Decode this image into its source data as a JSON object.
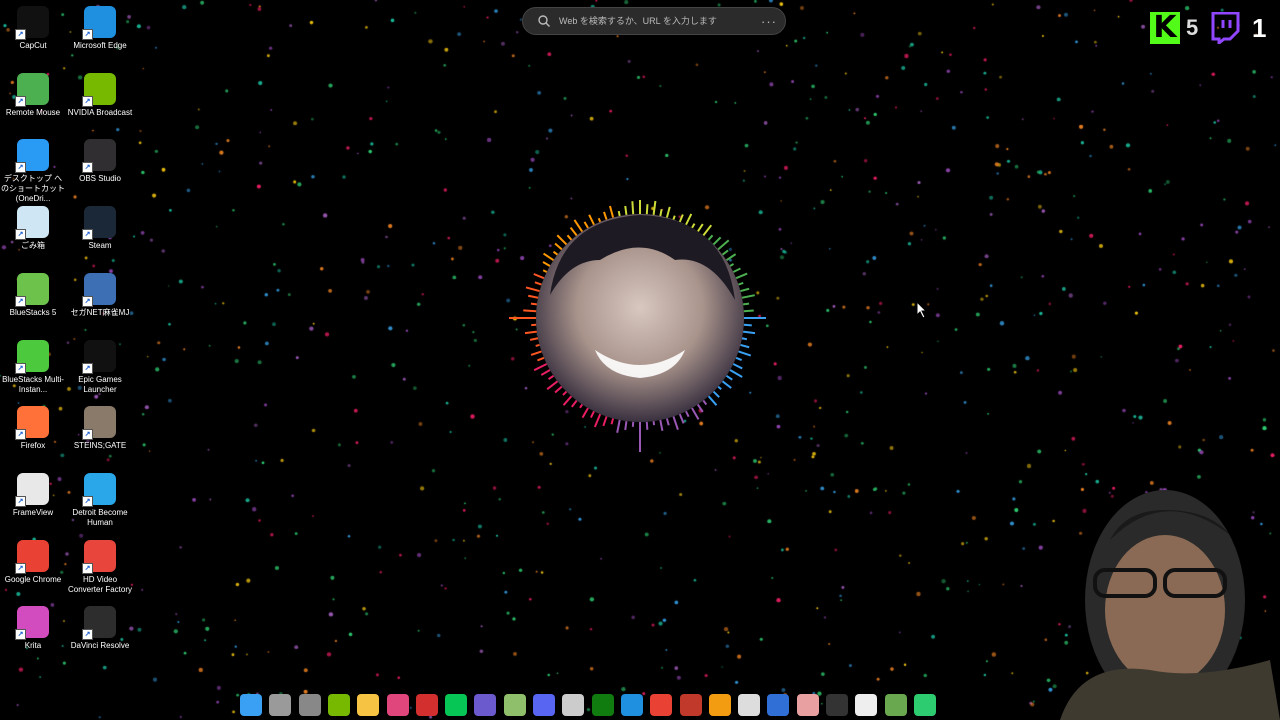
{
  "desktop_icons": [
    {
      "label": "CapCut",
      "icon": "capcut-icon",
      "color": "#111111"
    },
    {
      "label": "Microsoft Edge",
      "icon": "edge-icon",
      "color": "#1f8fe0"
    },
    {
      "label": "Remote Mouse",
      "icon": "remote-mouse-icon",
      "color": "#4caf50"
    },
    {
      "label": "NVIDIA Broadcast",
      "icon": "nvidia-broadcast-icon",
      "color": "#76b900"
    },
    {
      "label": "デスクトップ へのショートカット (OneDri...",
      "icon": "onedrive-icon",
      "color": "#2a9bf4"
    },
    {
      "label": "OBS Studio",
      "icon": "obs-icon",
      "color": "#302e31"
    },
    {
      "label": "ごみ箱",
      "icon": "recycle-bin-icon",
      "color": "#cfe6f5"
    },
    {
      "label": "Steam",
      "icon": "steam-icon",
      "color": "#1b2838"
    },
    {
      "label": "BlueStacks 5",
      "icon": "bluestacks-icon",
      "color": "#6cc24a"
    },
    {
      "label": "セガNET麻雀MJ",
      "icon": "sega-mj-icon",
      "color": "#3d6fb5"
    },
    {
      "label": "BlueStacks Multi-Instan...",
      "icon": "bluestacks-multi-icon",
      "color": "#4cc93c"
    },
    {
      "label": "Epic Games Launcher",
      "icon": "epic-games-icon",
      "color": "#111111"
    },
    {
      "label": "Firefox",
      "icon": "firefox-icon",
      "color": "#ff7139"
    },
    {
      "label": "STEINS;GATE",
      "icon": "steins-gate-icon",
      "color": "#8a7a6a"
    },
    {
      "label": "FrameView",
      "icon": "frameview-icon",
      "color": "#e8e8e8"
    },
    {
      "label": "Detroit Become Human",
      "icon": "detroit-icon",
      "color": "#2aa7e8"
    },
    {
      "label": "Google Chrome",
      "icon": "chrome-icon",
      "color": "#e94235"
    },
    {
      "label": "HD Video Converter Factory",
      "icon": "hd-video-converter-icon",
      "color": "#e8453c"
    },
    {
      "label": "Krita",
      "icon": "krita-icon",
      "color": "#d34cbf"
    },
    {
      "label": "DaVinci Resolve",
      "icon": "davinci-icon",
      "color": "#2d2d2d"
    }
  ],
  "search": {
    "placeholder": "Web を検索するか、URL を入力します",
    "more": "···"
  },
  "overlay": {
    "kick_letter": "K",
    "kick_count": "5",
    "twitch_count": "1"
  },
  "taskbar_icons": [
    {
      "icon": "windows-start-icon",
      "color": "#3aa0f3"
    },
    {
      "icon": "task-view-icon",
      "color": "#9a9a9a"
    },
    {
      "icon": "settings-icon",
      "color": "#888888"
    },
    {
      "icon": "nvidia-icon",
      "color": "#76b900"
    },
    {
      "icon": "file-explorer-icon",
      "color": "#f6c343"
    },
    {
      "icon": "lips-app-icon",
      "color": "#e0457b"
    },
    {
      "icon": "record-icon",
      "color": "#d32f2f"
    },
    {
      "icon": "line-icon",
      "color": "#06c755"
    },
    {
      "icon": "chat-app-icon",
      "color": "#6a5acd"
    },
    {
      "icon": "vue-app-icon",
      "color": "#8fbf6a"
    },
    {
      "icon": "discord-icon",
      "color": "#5865f2"
    },
    {
      "icon": "store-bag-icon",
      "color": "#cccccc"
    },
    {
      "icon": "xbox-icon",
      "color": "#107c10"
    },
    {
      "icon": "edge-icon",
      "color": "#1f8fe0"
    },
    {
      "icon": "chrome-icon",
      "color": "#e94235"
    },
    {
      "icon": "game-app-icon",
      "color": "#c0392b"
    },
    {
      "icon": "coin-app-icon",
      "color": "#f39c12"
    },
    {
      "icon": "arrow-app-icon",
      "color": "#dddddd"
    },
    {
      "icon": "calendar-app-icon",
      "color": "#2f6fd6"
    },
    {
      "icon": "image-app-icon",
      "color": "#e8a0a0"
    },
    {
      "icon": "dark-app-icon",
      "color": "#333333"
    },
    {
      "icon": "sd-app-icon",
      "color": "#eeeeee"
    },
    {
      "icon": "minecraft-icon",
      "color": "#6aa84f"
    },
    {
      "icon": "green-app-icon",
      "color": "#2ecc71"
    }
  ],
  "colors": {
    "kick": "#53fc18",
    "twitch": "#9146ff"
  }
}
